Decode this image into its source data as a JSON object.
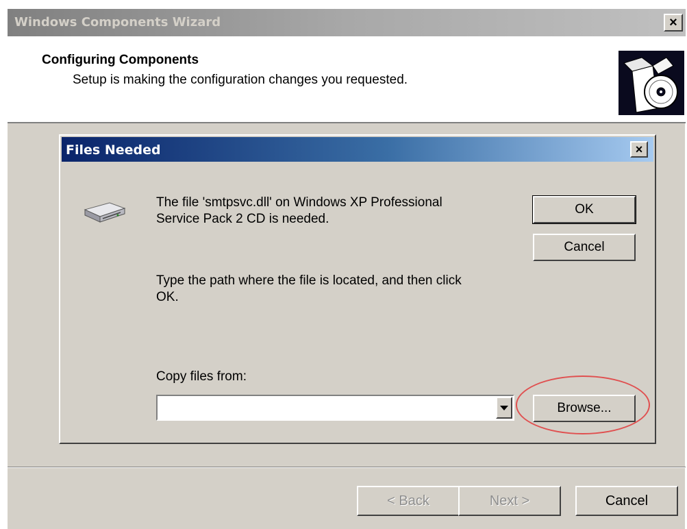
{
  "window": {
    "title": "Windows Components Wizard",
    "close_label": "×"
  },
  "header": {
    "title": "Configuring Components",
    "subtitle": "Setup is making the configuration changes you requested."
  },
  "files_dialog": {
    "title": "Files Needed",
    "close_label": "×",
    "message_line1": "The file 'smtpsvc.dll' on Windows XP Professional",
    "message_line2": "Service Pack 2 CD is needed.",
    "instruction_line1": "Type the path where the file is located, and then click",
    "instruction_line2": "OK.",
    "copy_from_label": "Copy files from:",
    "copy_from_value": "",
    "ok_label": "OK",
    "cancel_label": "Cancel",
    "browse_label": "Browse..."
  },
  "footer": {
    "back_label": "< Back",
    "next_label": "Next >",
    "cancel_label": "Cancel"
  },
  "colors": {
    "dialog_bg": "#d4d0c8",
    "titlebar_active_start": "#0a246a",
    "titlebar_active_end": "#a6caf0",
    "titlebar_inactive": "#808080",
    "highlight_ellipse": "#e05050"
  },
  "icons": {
    "wizard": "box-with-cd-icon",
    "drive": "cd-drive-icon",
    "dropdown": "triangle-down-icon"
  }
}
